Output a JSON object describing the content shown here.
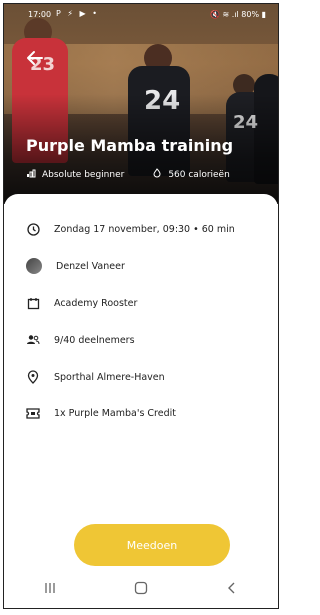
{
  "status": {
    "time": "17:00",
    "left_icons": "P ⚡ ▶ •",
    "right_icons": "🔇 ≋ .ıl 80% ▮"
  },
  "hero": {
    "jersey_numbers": [
      "23",
      "24",
      "24"
    ]
  },
  "training": {
    "title": "Purple Mamba training",
    "level": "Absolute beginner",
    "calories": "560 calorieën"
  },
  "details": {
    "datetime": "Zondag 17 november, 09:30 • 60 min",
    "trainer": "Denzel Vaneer",
    "schedule": "Academy Rooster",
    "participants": "9/40 deelnemers",
    "location": "Sporthal Almere-Haven",
    "credit": "1x Purple Mamba's Credit"
  },
  "cta": {
    "label": "Meedoen"
  },
  "colors": {
    "accent": "#efc635"
  },
  "icons": {
    "back": "arrow-left-icon",
    "level": "bars-icon",
    "calories": "flame-icon",
    "datetime": "clock-icon",
    "schedule": "calendar-icon",
    "participants": "people-icon",
    "location": "location-pin-icon",
    "credit": "ticket-icon"
  }
}
